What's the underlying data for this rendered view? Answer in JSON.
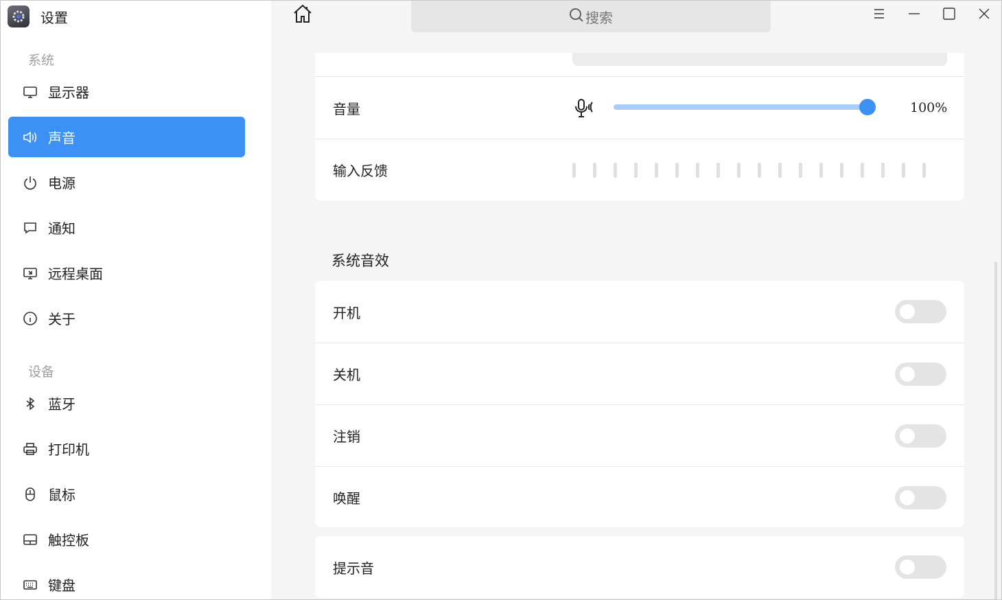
{
  "app": {
    "title": "设置"
  },
  "sidebar": {
    "sections": [
      {
        "label": "系统",
        "items": [
          {
            "label": "显示器",
            "icon": "monitor-icon"
          },
          {
            "label": "声音",
            "icon": "speaker-icon",
            "active": true
          },
          {
            "label": "电源",
            "icon": "power-icon"
          },
          {
            "label": "通知",
            "icon": "chat-bubble-icon"
          },
          {
            "label": "远程桌面",
            "icon": "remote-desktop-icon"
          },
          {
            "label": "关于",
            "icon": "info-icon"
          }
        ]
      },
      {
        "label": "设备",
        "items": [
          {
            "label": "蓝牙",
            "icon": "bluetooth-icon"
          },
          {
            "label": "打印机",
            "icon": "printer-icon"
          },
          {
            "label": "鼠标",
            "icon": "mouse-icon"
          },
          {
            "label": "触控板",
            "icon": "touchpad-icon"
          },
          {
            "label": "键盘",
            "icon": "keyboard-icon"
          }
        ]
      }
    ]
  },
  "search": {
    "placeholder": "搜索"
  },
  "input": {
    "volume_label": "音量",
    "volume_value": "100%",
    "volume_level": 1.0,
    "feedback_label": "输入反馈",
    "feedback_level": 0.0
  },
  "sound_effects": {
    "title": "系统音效",
    "items": [
      {
        "label": "开机",
        "enabled": false
      },
      {
        "label": "关机",
        "enabled": false
      },
      {
        "label": "注销",
        "enabled": false
      },
      {
        "label": "唤醒",
        "enabled": false
      }
    ],
    "notice": {
      "label": "提示音",
      "enabled": false
    }
  },
  "colors": {
    "accent": "#3d91f5",
    "slider_track": "#a9cdfa",
    "toggle_off": "#e4e4e4"
  }
}
